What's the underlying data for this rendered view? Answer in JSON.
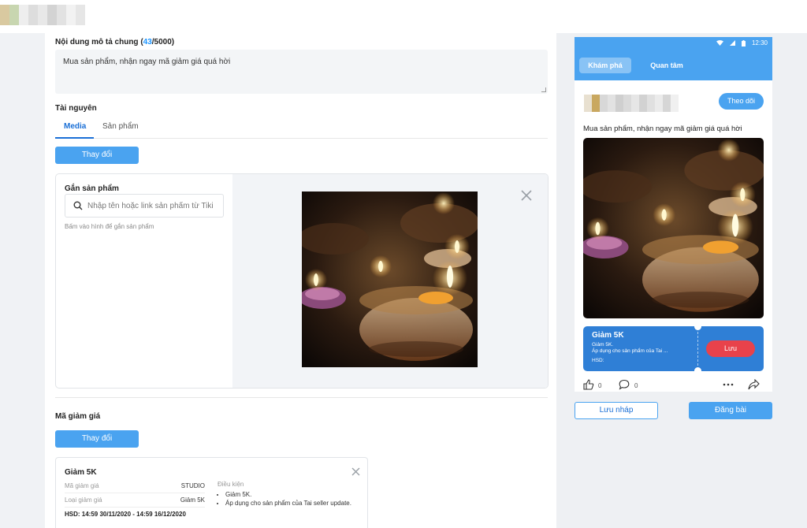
{
  "description": {
    "label_prefix": "Nội dung mô tả chung (",
    "count": "43",
    "label_suffix": "/5000)",
    "text": "Mua sản phẩm, nhận ngay mã giảm giá quá hời"
  },
  "resources": {
    "title": "Tài nguyên",
    "tabs": [
      "Media",
      "Sản phẩm"
    ],
    "change_button": "Thay đổi",
    "attach_title": "Gắn sản phẩm",
    "search_placeholder": "Nhập tên hoặc link sản phẩm từ Tiki",
    "hint": "Bấm vào hình để gắn sản phẩm"
  },
  "voucher_section": {
    "title": "Mã giảm giá",
    "change_button": "Thay đổi",
    "card": {
      "title": "Giảm 5K",
      "rows": [
        {
          "label": "Mã giảm giá",
          "value": "STUDIO"
        },
        {
          "label": "Loại giảm giá",
          "value": "Giảm 5K"
        }
      ],
      "hsd": "HSD: 14:59 30/11/2020 - 14:59 16/12/2020",
      "conditions_title": "Điều kiện",
      "conditions": [
        "Giảm 5K.",
        "Áp dụng cho sản phẩm của Tai seller update."
      ]
    }
  },
  "preview": {
    "time": "12:30",
    "tabs": [
      "Khám phá",
      "Quan tâm"
    ],
    "follow_button": "Theo dõi",
    "caption": "Mua sản phẩm, nhận ngay mã giảm giá quá hời",
    "voucher": {
      "title": "Giảm 5K",
      "line1": "Giảm 5K.",
      "line2": "Áp dụng cho sản phẩm của Tai ...",
      "line3": "HSD:",
      "save": "Lưu"
    },
    "likes": "0",
    "comments": "0"
  },
  "footer": {
    "draft_button": "Lưu nháp",
    "publish_button": "Đăng bài"
  },
  "colors": {
    "accent": "#4aa3f0",
    "link": "#1a6fd6",
    "voucher_bg": "#2f7fd6",
    "save_red": "#e8424b"
  },
  "icons": [
    "search-icon",
    "close-icon",
    "wifi-icon",
    "signal-icon",
    "battery-icon",
    "like-icon",
    "comment-icon",
    "more-icon",
    "share-icon"
  ]
}
